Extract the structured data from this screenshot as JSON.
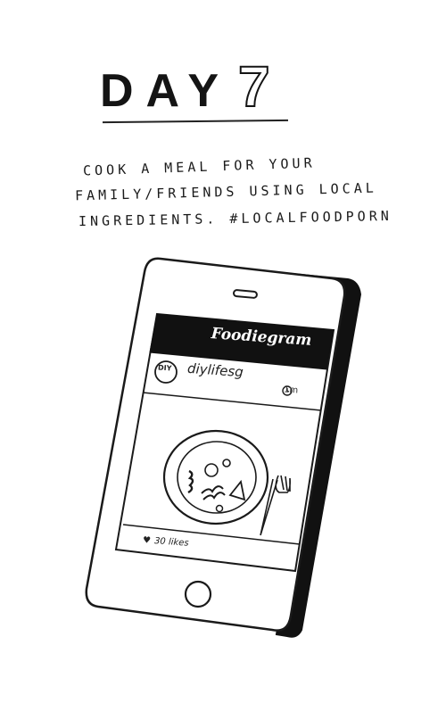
{
  "header": {
    "day_label": "DAY",
    "day_number": "7"
  },
  "task": {
    "line1": "COOK A MEAL FOR YOUR",
    "line2": "FAMILY/FRIENDS USING LOCAL",
    "line3": "INGREDIENTS. #LOCALFOODPORN"
  },
  "phone": {
    "app_name": "Foodiegram",
    "avatar_text": "DIY",
    "username": "diylifesg",
    "time": "1m",
    "likes": "30 likes"
  }
}
